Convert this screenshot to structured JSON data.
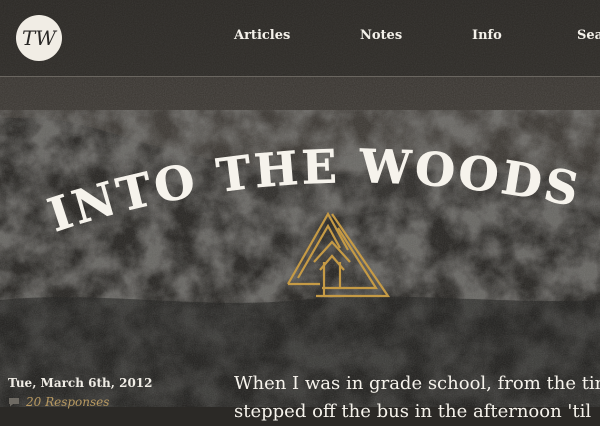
{
  "nav": {
    "logo_text": "TW",
    "items": [
      {
        "label": "Articles"
      },
      {
        "label": "Notes"
      },
      {
        "label": "Info"
      },
      {
        "label": "Sear"
      }
    ]
  },
  "hero": {
    "title": "INTO THE WOODS"
  },
  "post": {
    "date": "Tue, March 6th, 2012",
    "responses_label": "20 Responses",
    "body_line_1": "When I was in grade school, from the tim",
    "body_line_2": "stepped off the bus in the afternoon 'til"
  },
  "colors": {
    "accent": "#b99a61",
    "emblem": "#c59a45",
    "text": "#f4f1ea"
  }
}
